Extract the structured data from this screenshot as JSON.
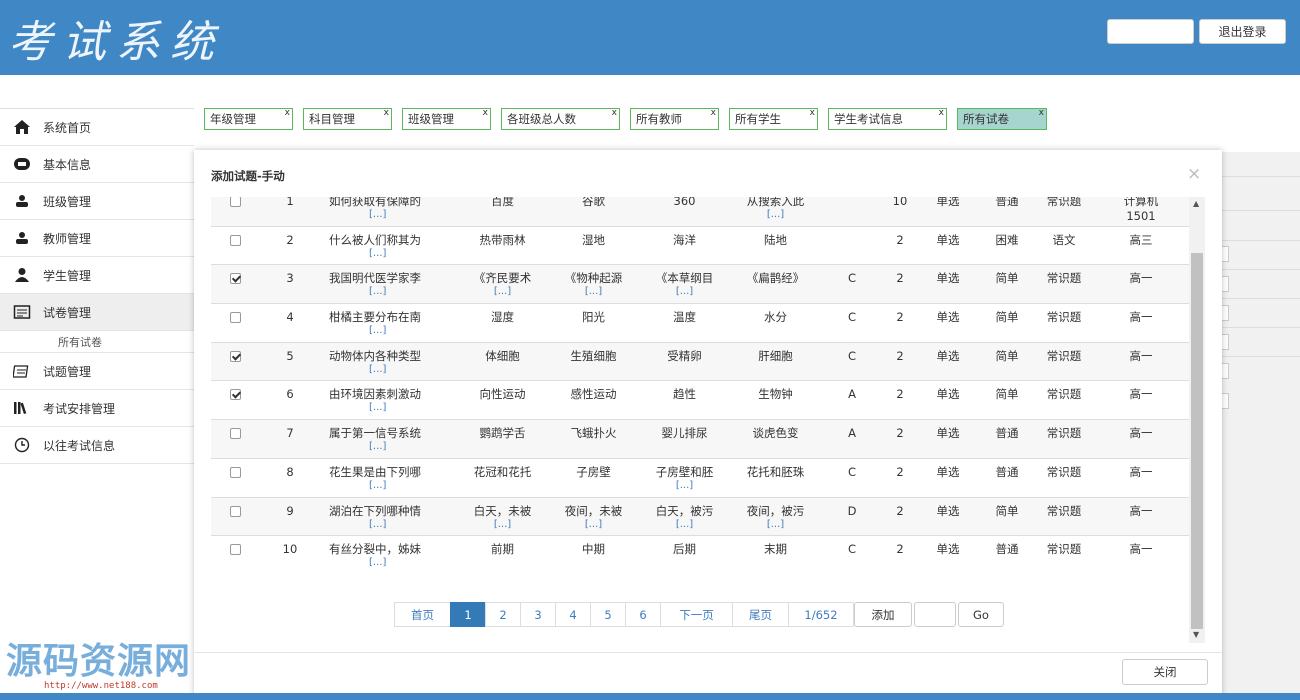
{
  "header": {
    "logo": "考试系统",
    "logout_label": "退出登录",
    "user_box_value": ""
  },
  "sidebar": {
    "items": [
      {
        "label": "系统首页",
        "icon": "home-icon"
      },
      {
        "label": "基本信息",
        "icon": "info-icon"
      },
      {
        "label": "班级管理",
        "icon": "group-icon"
      },
      {
        "label": "教师管理",
        "icon": "group-icon"
      },
      {
        "label": "学生管理",
        "icon": "user-icon"
      },
      {
        "label": "试卷管理",
        "icon": "paper-icon"
      },
      {
        "label": "试题管理",
        "icon": "question-icon"
      },
      {
        "label": "考试安排管理",
        "icon": "books-icon"
      },
      {
        "label": "以往考试信息",
        "icon": "clock-icon"
      }
    ],
    "submenu_label": "所有试卷"
  },
  "tabs": [
    {
      "label": "年级管理"
    },
    {
      "label": "科目管理"
    },
    {
      "label": "班级管理"
    },
    {
      "label": "各班级总人数"
    },
    {
      "label": "所有教师"
    },
    {
      "label": "所有学生"
    },
    {
      "label": "学生考试信息"
    },
    {
      "label": "所有试卷",
      "active": true
    }
  ],
  "tab_close": "x",
  "modal": {
    "title": "添加试题-手动",
    "close_icon": "×",
    "close_button": "关闭",
    "more_text": "[...]"
  },
  "rows": [
    {
      "checked": false,
      "no": "1",
      "q": "如何获取有保障的",
      "a": "百度",
      "b": "谷歌",
      "c": "360",
      "d": "从搜索入此",
      "ans": "",
      "score": "10",
      "type": "单选",
      "level": "普通",
      "cat": "常识题",
      "grade": "计算机",
      "grade2": "1501",
      "more_q": true,
      "more_d": true
    },
    {
      "checked": false,
      "no": "2",
      "q": "什么被人们称其为",
      "a": "热带雨林",
      "b": "湿地",
      "c": "海洋",
      "d": "陆地",
      "ans": "",
      "score": "2",
      "type": "单选",
      "level": "困难",
      "cat": "语文",
      "grade": "高三",
      "more_q": true
    },
    {
      "checked": true,
      "no": "3",
      "q": "我国明代医学家李",
      "a": "《齐民要术",
      "b": "《物种起源",
      "c": "《本草纲目",
      "d": "《扁鹊经》",
      "ans": "C",
      "score": "2",
      "type": "单选",
      "level": "简单",
      "cat": "常识题",
      "grade": "高一",
      "more_q": true,
      "more_a": true,
      "more_b": true,
      "more_c": true
    },
    {
      "checked": false,
      "no": "4",
      "q": "柑橘主要分布在南",
      "a": "湿度",
      "b": "阳光",
      "c": "温度",
      "d": "水分",
      "ans": "C",
      "score": "2",
      "type": "单选",
      "level": "简单",
      "cat": "常识题",
      "grade": "高一",
      "more_q": true
    },
    {
      "checked": true,
      "no": "5",
      "q": "动物体内各种类型",
      "a": "体细胞",
      "b": "生殖细胞",
      "c": "受精卵",
      "d": "肝细胞",
      "ans": "C",
      "score": "2",
      "type": "单选",
      "level": "简单",
      "cat": "常识题",
      "grade": "高一",
      "more_q": true
    },
    {
      "checked": true,
      "no": "6",
      "q": "由环境因素刺激动",
      "a": "向性运动",
      "b": "感性运动",
      "c": "趋性",
      "d": "生物钟",
      "ans": "A",
      "score": "2",
      "type": "单选",
      "level": "简单",
      "cat": "常识题",
      "grade": "高一",
      "more_q": true
    },
    {
      "checked": false,
      "no": "7",
      "q": "属于第一信号系统",
      "a": "鹦鹉学舌",
      "b": "飞蛾扑火",
      "c": "婴儿排尿",
      "d": "谈虎色变",
      "ans": "A",
      "score": "2",
      "type": "单选",
      "level": "普通",
      "cat": "常识题",
      "grade": "高一",
      "more_q": true
    },
    {
      "checked": false,
      "no": "8",
      "q": "花生果是由下列哪",
      "a": "花冠和花托",
      "b": "子房壁",
      "c": "子房壁和胚",
      "d": "花托和胚珠",
      "ans": "C",
      "score": "2",
      "type": "单选",
      "level": "普通",
      "cat": "常识题",
      "grade": "高一",
      "more_q": true,
      "more_c": true
    },
    {
      "checked": false,
      "no": "9",
      "q": "湖泊在下列哪种情",
      "a": "白天，未被",
      "b": "夜间，未被",
      "c": "白天，被污",
      "d": "夜间，被污",
      "ans": "D",
      "score": "2",
      "type": "单选",
      "level": "简单",
      "cat": "常识题",
      "grade": "高一",
      "more_q": true,
      "more_a": true,
      "more_b": true,
      "more_c": true,
      "more_d": true
    },
    {
      "checked": false,
      "no": "10",
      "q": "有丝分裂中，姊妹",
      "a": "前期",
      "b": "中期",
      "c": "后期",
      "d": "末期",
      "ans": "C",
      "score": "2",
      "type": "单选",
      "level": "普通",
      "cat": "常识题",
      "grade": "高一",
      "more_q": true
    }
  ],
  "pager": {
    "first": "首页",
    "pages": [
      "1",
      "2",
      "3",
      "4",
      "5",
      "6"
    ],
    "current": "1",
    "next": "下一页",
    "last": "尾页",
    "count": "1/652",
    "add": "添加",
    "jump_value": "",
    "go": "Go"
  },
  "watermark": {
    "text": "源码资源网",
    "url": "http://www.net188.com"
  },
  "colors": {
    "header": "#3f88c5",
    "active_tab": "#a6d4cf",
    "tab_border": "#5cb85c",
    "pager_active": "#337ab7"
  }
}
